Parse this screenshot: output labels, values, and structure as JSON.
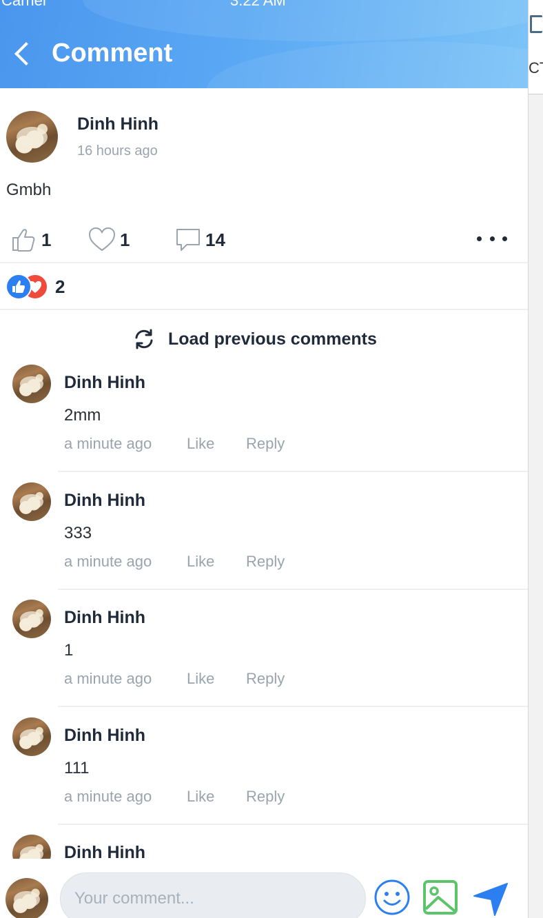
{
  "status_bar": {
    "carrier": "Carrier",
    "time": "3:22 AM"
  },
  "header": {
    "title": "Comment"
  },
  "side_panel": {
    "fragment": "CT"
  },
  "post": {
    "author": "Dinh Hinh",
    "time": "16 hours ago",
    "text": "Gmbh",
    "like_count": "1",
    "heart_count": "1",
    "comment_count": "14",
    "reaction_total": "2"
  },
  "load_previous_label": "Load previous comments",
  "comments": [
    {
      "author": "Dinh Hinh",
      "text": "2mm",
      "time": "a minute ago",
      "like_label": "Like",
      "reply_label": "Reply"
    },
    {
      "author": "Dinh Hinh",
      "text": "333",
      "time": "a minute ago",
      "like_label": "Like",
      "reply_label": "Reply"
    },
    {
      "author": "Dinh Hinh",
      "text": "1",
      "time": "a minute ago",
      "like_label": "Like",
      "reply_label": "Reply"
    },
    {
      "author": "Dinh Hinh",
      "text": "111",
      "time": "a minute ago",
      "like_label": "Like",
      "reply_label": "Reply"
    },
    {
      "author": "Dinh Hinh",
      "text": "",
      "time": "",
      "like_label": "",
      "reply_label": ""
    }
  ],
  "composer": {
    "placeholder": "Your comment..."
  },
  "colors": {
    "accent": "#2b7ff0",
    "header_start": "#4a96ee",
    "header_end": "#7cc3f7",
    "image_icon": "#5cc46b",
    "muted_text": "#9aa3ae"
  }
}
